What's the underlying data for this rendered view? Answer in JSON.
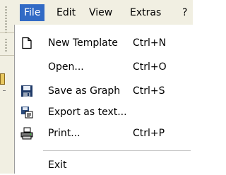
{
  "menubar": {
    "items": [
      {
        "label": "File"
      },
      {
        "label": "Edit"
      },
      {
        "label": "View"
      },
      {
        "label": "Extras"
      },
      {
        "label": "?"
      }
    ]
  },
  "file_menu": {
    "items": [
      {
        "label": "New Template",
        "shortcut": "Ctrl+N",
        "icon": "new-document-icon"
      },
      {
        "label": "Open...",
        "shortcut": "Ctrl+O",
        "icon": ""
      },
      {
        "label": "Save as Graph",
        "shortcut": "Ctrl+S",
        "icon": "floppy-disk-icon"
      },
      {
        "label": "Export as text...",
        "shortcut": "",
        "icon": "export-text-icon"
      },
      {
        "label": "Print...",
        "shortcut": "Ctrl+P",
        "icon": "printer-icon"
      },
      {
        "label": "Exit",
        "shortcut": "",
        "icon": ""
      }
    ]
  },
  "colors": {
    "highlight": "#316ac5",
    "menubar_bg": "#f1efe2",
    "menu_bg": "#ffffff"
  }
}
